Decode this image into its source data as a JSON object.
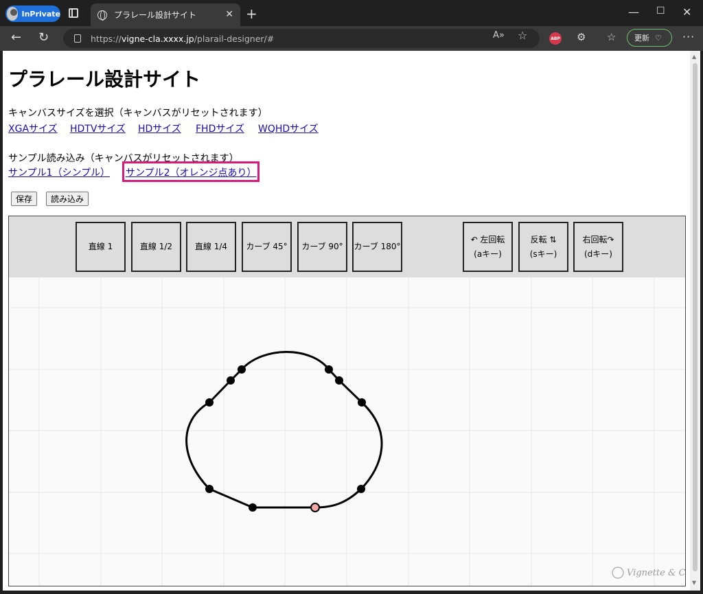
{
  "browser": {
    "inprivate_label": "InPrivate",
    "tab_title": "プラレール設計サイト",
    "url_prefix": "https://",
    "url_host": "vigne-cla.xxxx.jp",
    "url_path": "/plarail-designer/#",
    "update_label": "更新"
  },
  "page": {
    "title": "プラレール設計サイト",
    "canvas_size_label": "キャンバスサイズを選択（キャンバスがリセットされます）",
    "canvas_sizes": [
      "XGAサイズ",
      "HDTVサイズ",
      "HDサイズ",
      "FHDサイズ",
      "WQHDサイズ"
    ],
    "sample_label": "サンプル読み込み（キャンバスがリセットされます）",
    "samples": [
      "サンプル1（シンプル）",
      "サンプル2（オレンジ点あり）"
    ],
    "save_label": "保存",
    "load_label": "読み込み"
  },
  "toolbar": {
    "pieces": [
      "直線 1",
      "直線 1/2",
      "直線 1/4",
      "カーブ 45°",
      "カーブ 90°",
      "カーブ 180°"
    ],
    "rotate_left": {
      "line1": "↶ 左回転",
      "line2": "(aキー)"
    },
    "flip": {
      "line1": "反転 ⇅",
      "line2": "(sキー)"
    },
    "rotate_right": {
      "line1": "右回転↷",
      "line2": "(dキー)"
    }
  },
  "watermark_text": "Vignette & Clarity",
  "colors": {
    "highlight": "#d81b7a",
    "link": "#1a0dab",
    "toolbar_bg": "#dddddd",
    "track": "#000000",
    "special_dot": "#f4a6a6"
  }
}
